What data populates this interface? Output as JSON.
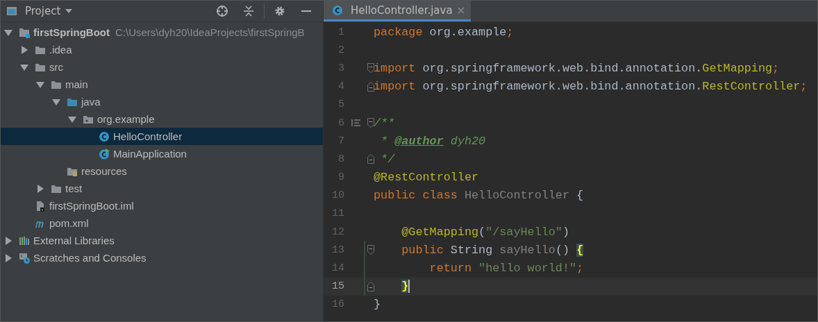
{
  "project_panel": {
    "title": "Project",
    "tree": [
      {
        "label": "firstSpringBoot",
        "path": "C:\\Users\\dyh20\\IdeaProjects\\firstSpringB",
        "kind": "module",
        "expanded": true,
        "selected": false,
        "children": [
          {
            "label": ".idea",
            "kind": "folder",
            "expanded": false,
            "selected": false
          },
          {
            "label": "src",
            "kind": "folder",
            "expanded": true,
            "selected": false,
            "children": [
              {
                "label": "main",
                "kind": "folder",
                "expanded": true,
                "selected": false,
                "children": [
                  {
                    "label": "java",
                    "kind": "source",
                    "expanded": true,
                    "selected": false,
                    "children": [
                      {
                        "label": "org.example",
                        "kind": "package",
                        "expanded": true,
                        "selected": false,
                        "children": [
                          {
                            "label": "HelloController",
                            "kind": "class",
                            "selected": true
                          },
                          {
                            "label": "MainApplication",
                            "kind": "runnable",
                            "selected": false
                          }
                        ]
                      }
                    ]
                  },
                  {
                    "label": "resources",
                    "kind": "resources",
                    "selected": false
                  }
                ]
              },
              {
                "label": "test",
                "kind": "folder",
                "expanded": false,
                "selected": false
              }
            ]
          },
          {
            "label": "firstSpringBoot.iml",
            "kind": "file",
            "selected": false
          },
          {
            "label": "pom.xml",
            "kind": "maven",
            "selected": false
          }
        ]
      },
      {
        "label": "External Libraries",
        "kind": "libraries",
        "expanded": false,
        "selected": false
      },
      {
        "label": "Scratches and Consoles",
        "kind": "scratches",
        "expanded": false,
        "selected": false
      }
    ]
  },
  "editor": {
    "tabs": [
      {
        "label": "HelloController.java",
        "selected": true
      }
    ],
    "lines": [
      {
        "number": "1",
        "current": false,
        "tokens": [
          {
            "kind": "keyword",
            "text": "package"
          },
          {
            "kind": "plain",
            "text": " org.example"
          },
          {
            "kind": "semi",
            "text": ";"
          }
        ]
      },
      {
        "number": "2",
        "current": false
      },
      {
        "number": "3",
        "current": false,
        "fold_start": true,
        "tokens": [
          {
            "kind": "keyword",
            "text": "import"
          },
          {
            "kind": "plain",
            "text": " org.springframework.web.bind.annotation."
          },
          {
            "kind": "annotation",
            "text": "GetMapping"
          },
          {
            "kind": "semi",
            "text": ";"
          }
        ]
      },
      {
        "number": "4",
        "current": false,
        "fold_end": true,
        "tokens": [
          {
            "kind": "keyword",
            "text": "import"
          },
          {
            "kind": "plain",
            "text": " org.springframework.web.bind.annotation."
          },
          {
            "kind": "annotation",
            "text": "RestController"
          },
          {
            "kind": "semi",
            "text": ";"
          }
        ]
      },
      {
        "number": "5",
        "current": false
      },
      {
        "number": "6",
        "current": false,
        "fold_start": true,
        "doc_toggle": true,
        "tokens": [
          {
            "kind": "comment",
            "text": "/**"
          }
        ]
      },
      {
        "number": "7",
        "current": false,
        "tokens": [
          {
            "kind": "comment",
            "text": " * "
          },
          {
            "kind": "doctag",
            "text": "@author"
          },
          {
            "kind": "comment",
            "text": " dyh20"
          }
        ]
      },
      {
        "number": "8",
        "current": false,
        "fold_end": true,
        "tokens": [
          {
            "kind": "comment",
            "text": " */"
          }
        ]
      },
      {
        "number": "9",
        "current": false,
        "tokens": [
          {
            "kind": "annotation",
            "text": "@RestController"
          }
        ]
      },
      {
        "number": "10",
        "current": false,
        "tokens": [
          {
            "kind": "keyword",
            "text": "public class"
          },
          {
            "kind": "unused",
            "text": " HelloController"
          },
          {
            "kind": "plain",
            "text": " {"
          }
        ]
      },
      {
        "number": "11",
        "current": false
      },
      {
        "number": "12",
        "current": false,
        "tokens": [
          {
            "kind": "annotation",
            "text": "    @GetMapping"
          },
          {
            "kind": "plain",
            "text": "("
          },
          {
            "kind": "string",
            "text": "\"/sayHello\""
          },
          {
            "kind": "plain",
            "text": ")"
          }
        ]
      },
      {
        "number": "13",
        "current": false,
        "changed": true,
        "fold_start": true,
        "tokens": [
          {
            "kind": "keyword",
            "text": "    public"
          },
          {
            "kind": "plain",
            "text": " String"
          },
          {
            "kind": "unused",
            "text": " sayHello"
          },
          {
            "kind": "plain",
            "text": "()"
          },
          {
            "kind": "brace",
            "text": " {"
          }
        ]
      },
      {
        "number": "14",
        "current": false,
        "changed": true,
        "tokens": [
          {
            "kind": "keyword",
            "text": "        return"
          },
          {
            "kind": "string",
            "text": " \"hello world!\""
          },
          {
            "kind": "semi",
            "text": ";"
          }
        ]
      },
      {
        "number": "15",
        "current": true,
        "changed": true,
        "fold_end": true,
        "tokens": [
          {
            "kind": "brace",
            "text": "    }"
          }
        ]
      },
      {
        "number": "16",
        "current": false,
        "tokens": [
          {
            "kind": "plain",
            "text": "}"
          }
        ]
      }
    ]
  }
}
